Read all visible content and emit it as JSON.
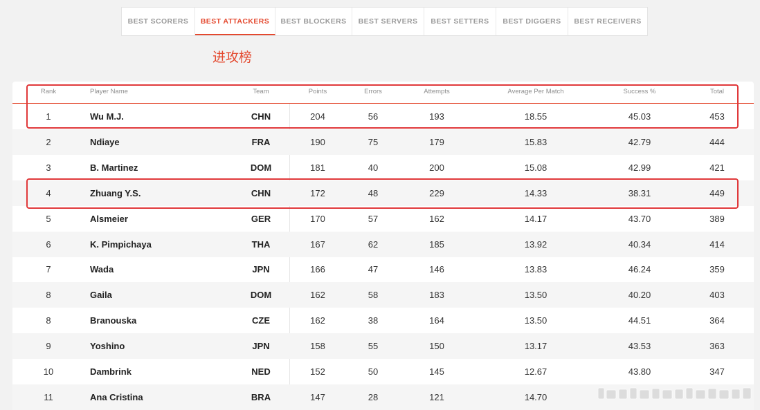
{
  "tabs": [
    {
      "label": "BEST SCORERS",
      "active": false
    },
    {
      "label": "BEST ATTACKERS",
      "active": true
    },
    {
      "label": "BEST BLOCKERS",
      "active": false
    },
    {
      "label": "BEST SERVERS",
      "active": false
    },
    {
      "label": "BEST SETTERS",
      "active": false
    },
    {
      "label": "BEST DIGGERS",
      "active": false
    },
    {
      "label": "BEST RECEIVERS",
      "active": false
    }
  ],
  "annotation_title": "进攻榜",
  "table": {
    "headers": {
      "rank": "Rank",
      "player": "Player Name",
      "team": "Team",
      "points": "Points",
      "errors": "Errors",
      "attempts": "Attempts",
      "avg": "Average Per Match",
      "success": "Success %",
      "total": "Total"
    },
    "rows": [
      {
        "rank": "1",
        "player": "Wu M.J.",
        "team": "CHN",
        "points": "204",
        "errors": "56",
        "attempts": "193",
        "avg": "18.55",
        "success": "45.03",
        "total": "453",
        "highlighted": true
      },
      {
        "rank": "2",
        "player": "Ndiaye",
        "team": "FRA",
        "points": "190",
        "errors": "75",
        "attempts": "179",
        "avg": "15.83",
        "success": "42.79",
        "total": "444",
        "highlighted": false
      },
      {
        "rank": "3",
        "player": "B. Martinez",
        "team": "DOM",
        "points": "181",
        "errors": "40",
        "attempts": "200",
        "avg": "15.08",
        "success": "42.99",
        "total": "421",
        "highlighted": false
      },
      {
        "rank": "4",
        "player": "Zhuang Y.S.",
        "team": "CHN",
        "points": "172",
        "errors": "48",
        "attempts": "229",
        "avg": "14.33",
        "success": "38.31",
        "total": "449",
        "highlighted": true
      },
      {
        "rank": "5",
        "player": "Alsmeier",
        "team": "GER",
        "points": "170",
        "errors": "57",
        "attempts": "162",
        "avg": "14.17",
        "success": "43.70",
        "total": "389",
        "highlighted": false
      },
      {
        "rank": "6",
        "player": "K. Pimpichaya",
        "team": "THA",
        "points": "167",
        "errors": "62",
        "attempts": "185",
        "avg": "13.92",
        "success": "40.34",
        "total": "414",
        "highlighted": false
      },
      {
        "rank": "7",
        "player": "Wada",
        "team": "JPN",
        "points": "166",
        "errors": "47",
        "attempts": "146",
        "avg": "13.83",
        "success": "46.24",
        "total": "359",
        "highlighted": false
      },
      {
        "rank": "8",
        "player": "Gaila",
        "team": "DOM",
        "points": "162",
        "errors": "58",
        "attempts": "183",
        "avg": "13.50",
        "success": "40.20",
        "total": "403",
        "highlighted": false
      },
      {
        "rank": "8",
        "player": "Branouska",
        "team": "CZE",
        "points": "162",
        "errors": "38",
        "attempts": "164",
        "avg": "13.50",
        "success": "44.51",
        "total": "364",
        "highlighted": false
      },
      {
        "rank": "9",
        "player": "Yoshino",
        "team": "JPN",
        "points": "158",
        "errors": "55",
        "attempts": "150",
        "avg": "13.17",
        "success": "43.53",
        "total": "363",
        "highlighted": false
      },
      {
        "rank": "10",
        "player": "Dambrink",
        "team": "NED",
        "points": "152",
        "errors": "50",
        "attempts": "145",
        "avg": "12.67",
        "success": "43.80",
        "total": "347",
        "highlighted": false
      },
      {
        "rank": "11",
        "player": "Ana Cristina",
        "team": "BRA",
        "points": "147",
        "errors": "28",
        "attempts": "121",
        "avg": "14.70",
        "success": "",
        "total": "",
        "highlighted": false
      }
    ]
  },
  "colors": {
    "accent": "#e4492f",
    "highlight_box": "#e0383a"
  }
}
